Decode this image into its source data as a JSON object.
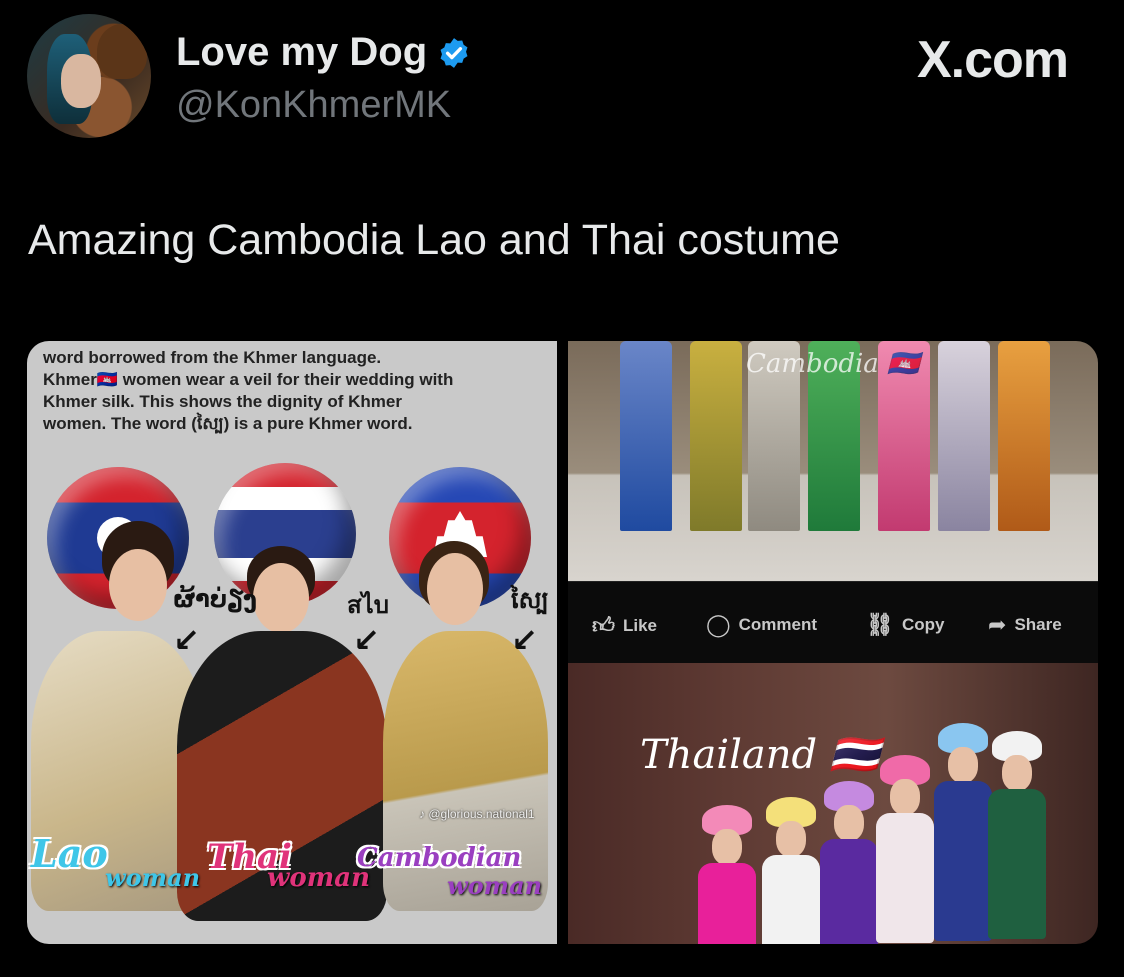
{
  "post": {
    "display_name": "Love my Dog",
    "handle": "@KonKhmerMK",
    "brand": "X.com",
    "text": "Amazing Cambodia Lao and Thai costume"
  },
  "left_image": {
    "caption_lines": [
      "word borrowed from the Khmer language.",
      "Khmer🇰🇭 women wear a veil for their wedding with",
      "Khmer silk. This shows the dignity of Khmer",
      "women. The word (ស្បៃ) is a pure Khmer word."
    ],
    "script_lao": "ຜ້າບ່ຽງ",
    "script_thai": "สไบ",
    "script_khmer": "ស្បៃ",
    "label_lao": "Lao",
    "label_thai": "Thai",
    "label_cambodian": "Cambodian",
    "label_woman": "woman",
    "watermark": "♪ @glorious.national1"
  },
  "right_top": {
    "label": "Cambodia 🇰🇭"
  },
  "fb_bar": {
    "like": "Like",
    "comment": "Comment",
    "copy": "Copy",
    "share": "Share"
  },
  "right_bottom": {
    "label": "Thailand 🇹🇭"
  },
  "colors": {
    "background": "#000000",
    "text": "#e7e9ea",
    "secondary": "#71767b",
    "verified": "#1d9bf0"
  }
}
